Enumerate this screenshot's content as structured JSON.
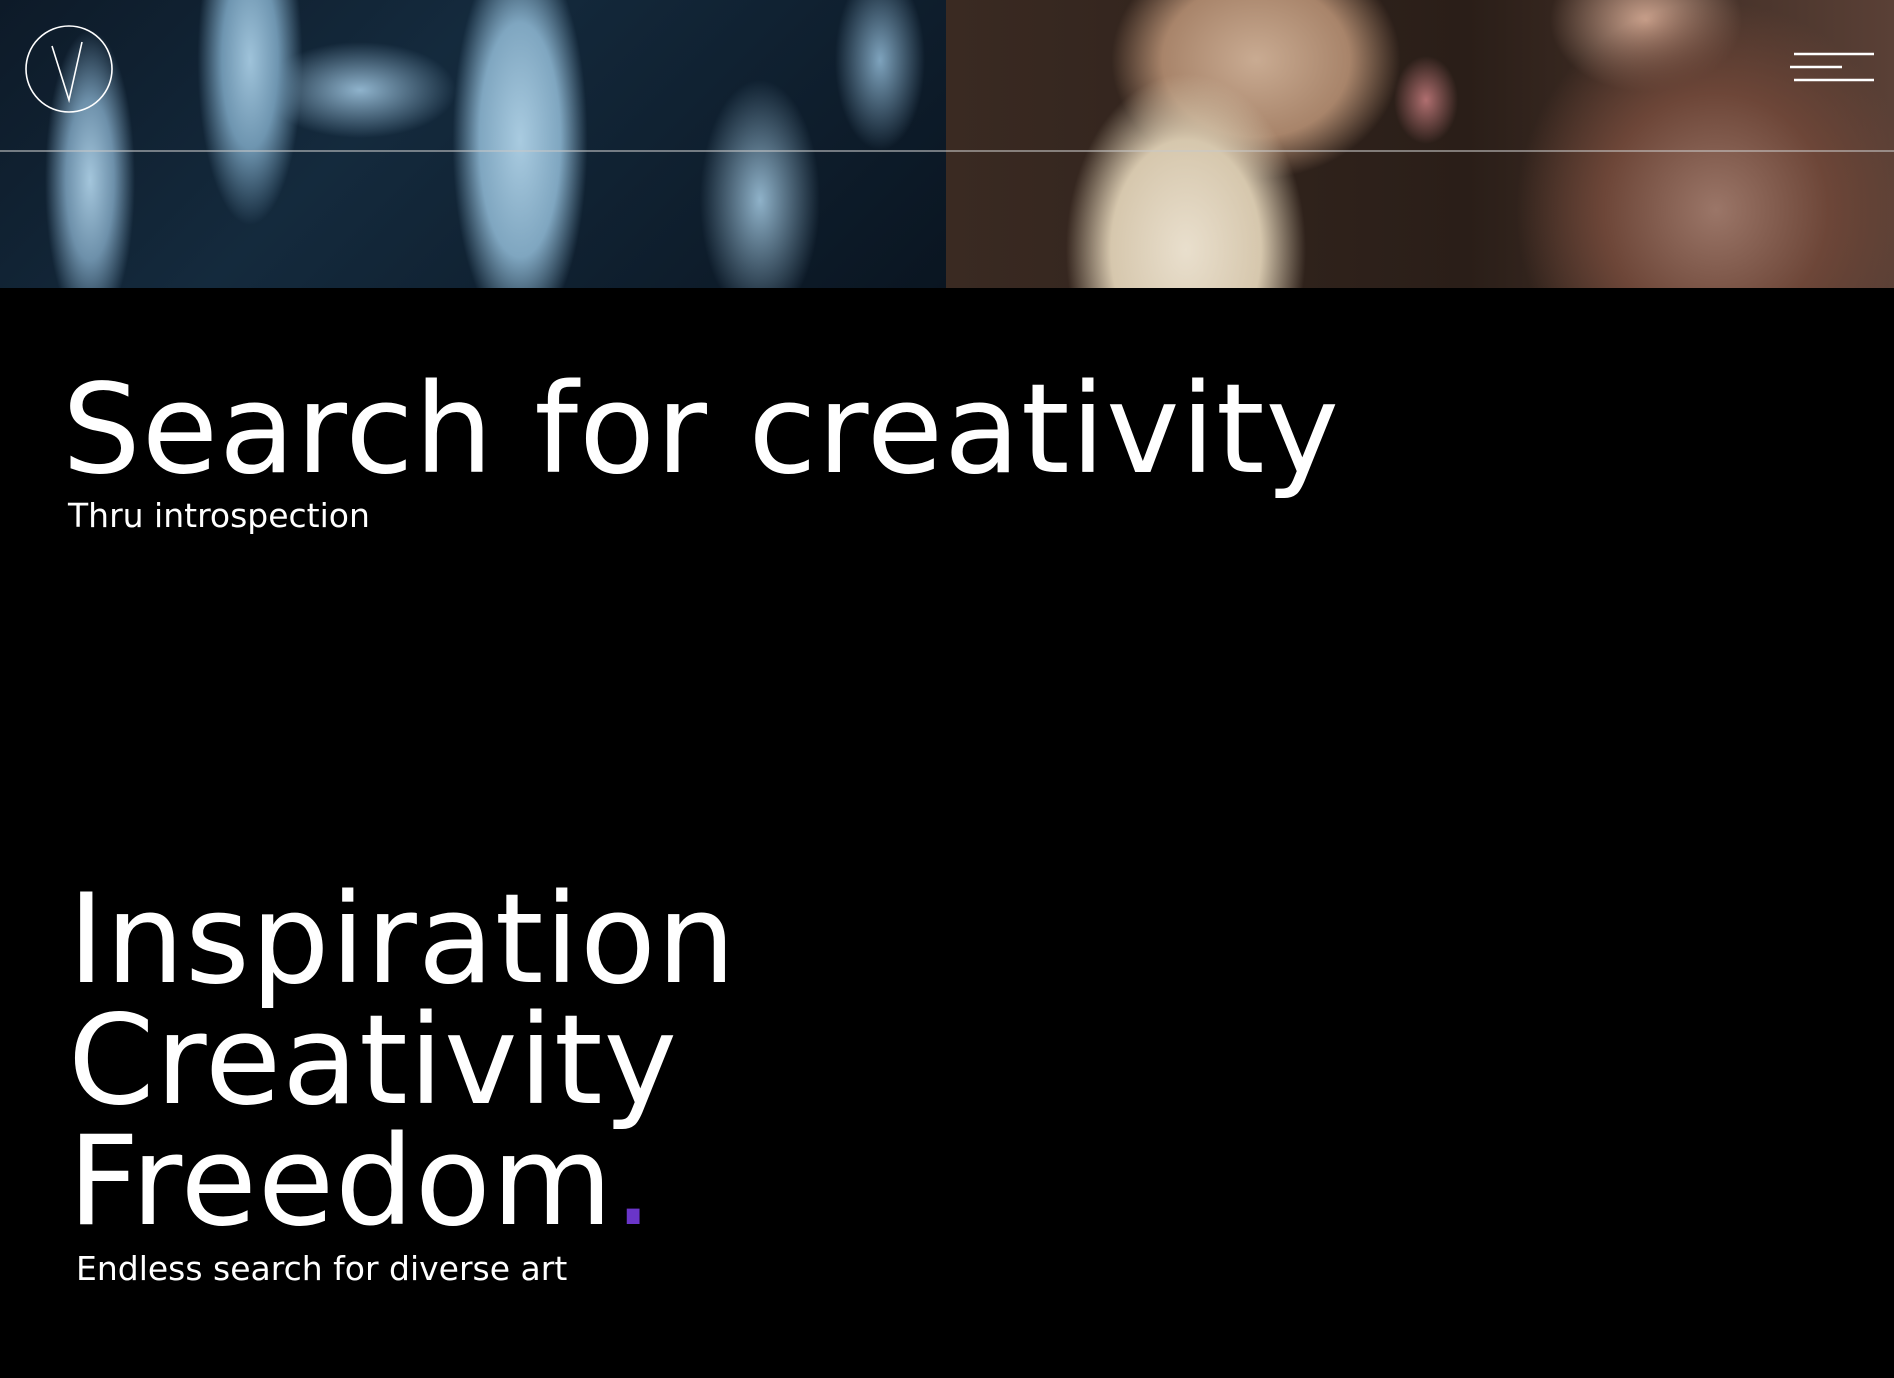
{
  "hero": {
    "left_image": "abstract-blue-tree-branches-image",
    "right_image": "vintage-photo-woman-sticking-out-tongue-image"
  },
  "header": {
    "logo_icon": "v-circle-logo-icon",
    "menu_icon": "hamburger-menu-icon"
  },
  "main": {
    "title": "Search for creativity",
    "subtitle": "Thru introspection",
    "words": [
      "Inspiration",
      "Creativity",
      "Freedom"
    ],
    "accent_dot": ".",
    "tagline": "Endless search for diverse art"
  },
  "colors": {
    "background": "#000000",
    "text": "#ffffff",
    "accent": "#6a35c9"
  }
}
